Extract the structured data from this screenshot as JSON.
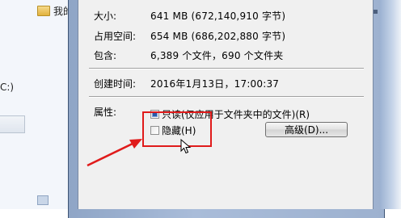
{
  "background": {
    "nav_item": "我的",
    "drive_fragment": "C:)"
  },
  "details": [
    {
      "label": "大小:",
      "value": "641 MB (672,140,910 字节)"
    },
    {
      "label": "占用空间:",
      "value": "654 MB (686,202,880 字节)"
    },
    {
      "label": "包含:",
      "value": "6,389 个文件，690 个文件夹"
    }
  ],
  "created": {
    "label": "创建时间:",
    "value": "2016年1月13日，17:00:37"
  },
  "attributes": {
    "label": "属性:",
    "readonly": {
      "text": "只读(仅应用于文件夹中的文件)(R)",
      "state": "indeterminate"
    },
    "hidden": {
      "text": "隐藏(H)",
      "checked": false
    },
    "advanced_button": "高级(D)..."
  },
  "colors": {
    "highlight": "#e01b1b",
    "dialog_bg": "#f0f0f0"
  }
}
